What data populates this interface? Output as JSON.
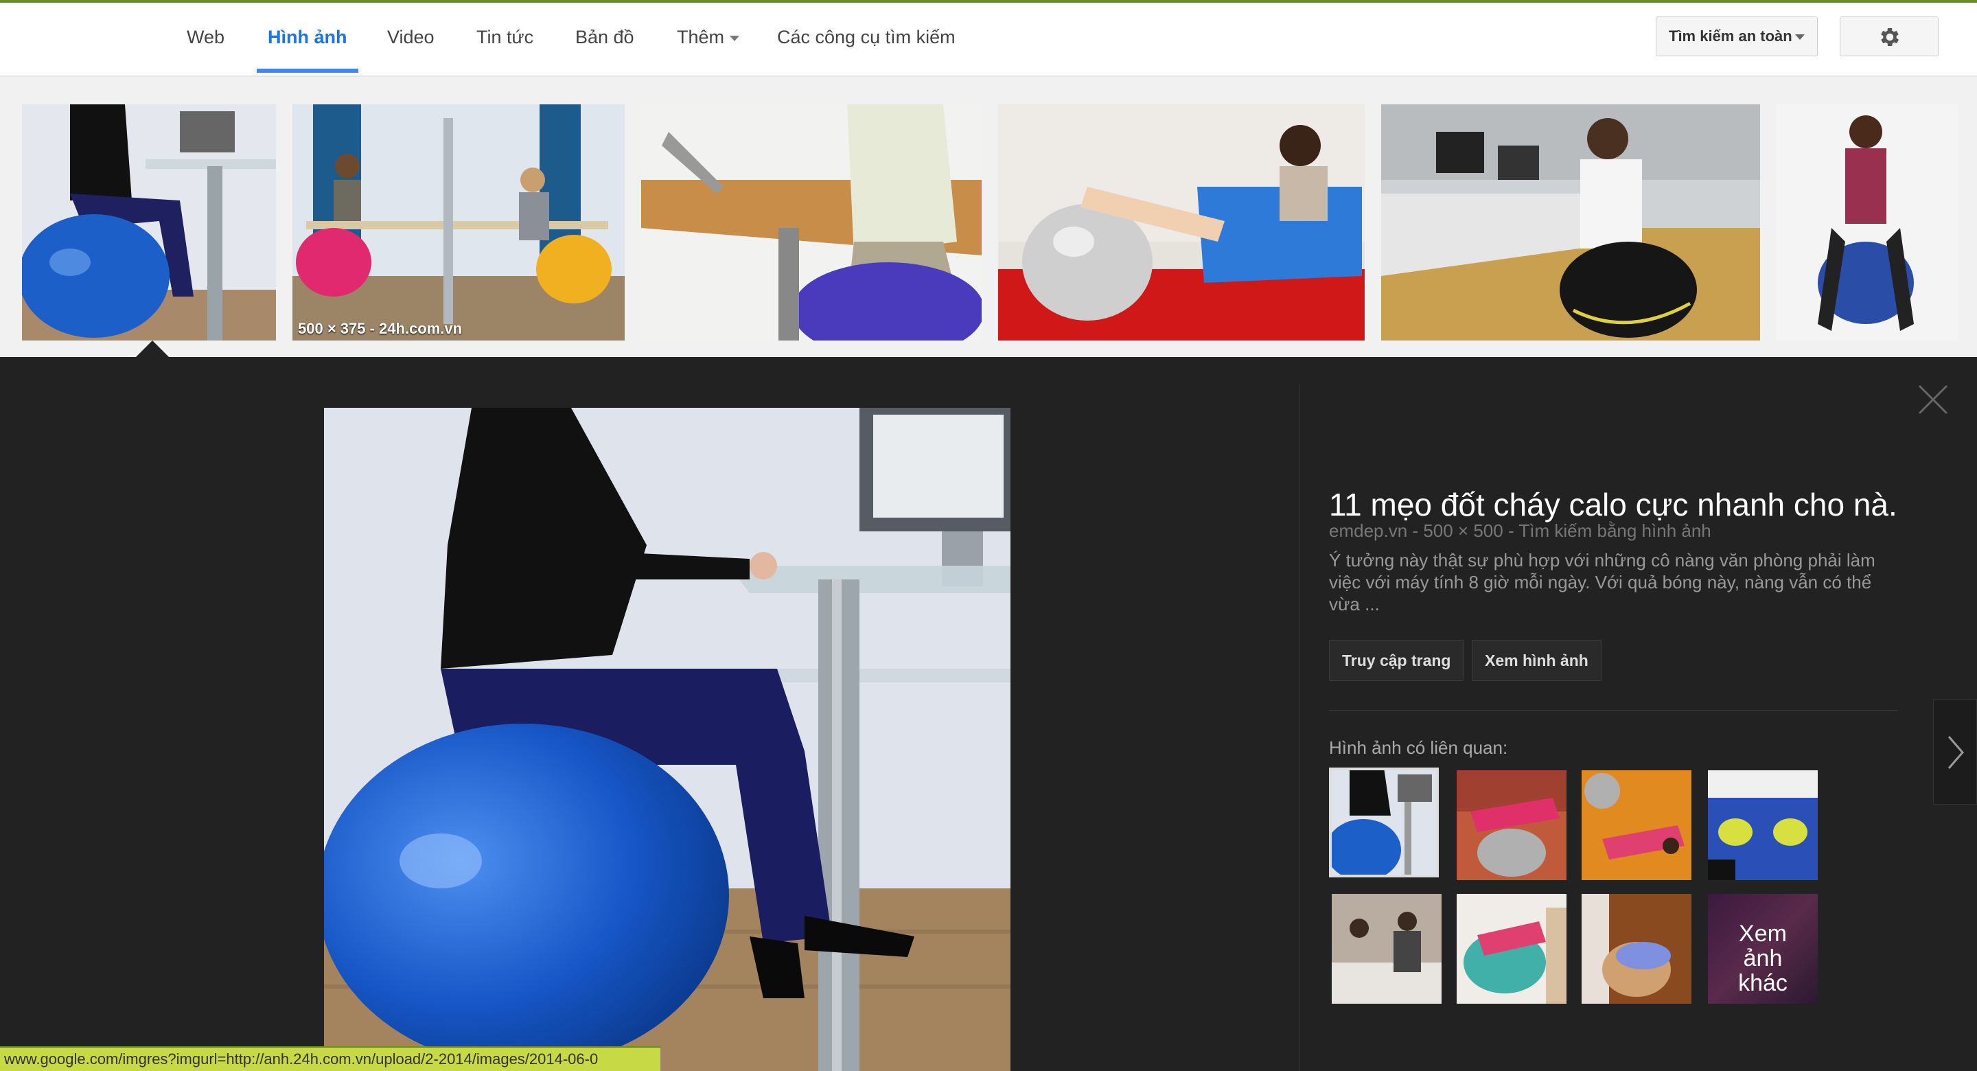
{
  "nav": {
    "tabs": [
      {
        "label": "Web"
      },
      {
        "label": "Hình ảnh"
      },
      {
        "label": "Video"
      },
      {
        "label": "Tin tức"
      },
      {
        "label": "Bản đồ"
      },
      {
        "label": "Thêm"
      },
      {
        "label": "Các công cụ tìm kiếm"
      }
    ],
    "safe_search": "Tìm kiếm an toàn",
    "settings_icon": "gear-icon"
  },
  "thumbnails": [
    {
      "caption": ""
    },
    {
      "caption": "500 × 375 - 24h.com.vn"
    },
    {
      "caption": ""
    },
    {
      "caption": ""
    },
    {
      "caption": ""
    },
    {
      "caption": ""
    }
  ],
  "preview": {
    "title": "11 mẹo đốt cháy calo cực nhanh cho nà...",
    "source": "emdep.vn",
    "dimensions": "500 × 500",
    "search_by_image": "Tìm kiếm bằng hình ảnh",
    "sep": "-",
    "description": "Ý tưởng này thật sự phù hợp với những cô nàng văn phòng phải làm việc với máy tính 8 giờ mỗi ngày. Với quả bóng này, nàng vẫn có thể vừa ...",
    "visit_button": "Truy cập trang",
    "view_button": "Xem hình ảnh",
    "related_label": "Hình ảnh có liên quan:",
    "more_label_1": "Xem",
    "more_label_2": "ảnh",
    "more_label_3": "khác"
  },
  "status_url": "www.google.com/imgres?imgurl=http://anh.24h.com.vn/upload/2-2014/images/2014-06-0"
}
